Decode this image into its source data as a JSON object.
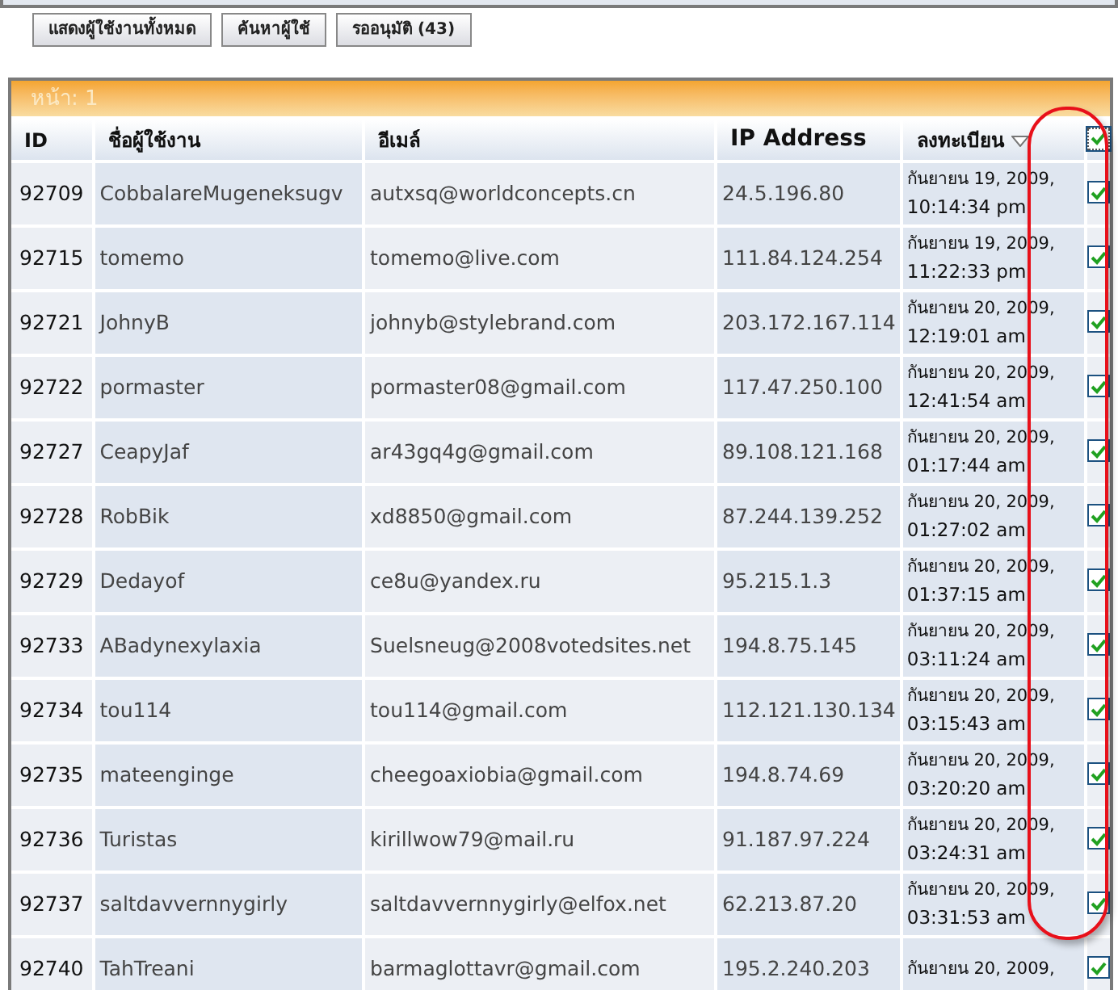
{
  "toolbar": {
    "buttons": [
      "แสดงผู้ใช้งานทั้งหมด",
      "ค้นหาผู้ใช้",
      "รออนุมัติ (43)"
    ]
  },
  "table": {
    "page_label": "หน้า: 1",
    "columns": [
      "ID",
      "ชื่อผู้ใช้งาน",
      "อีเมล์",
      "IP Address",
      "ลงทะเบียน"
    ],
    "select_all": {
      "checked": true
    },
    "rows": [
      {
        "id": "92709",
        "username": "CobbalareMugeneksugv",
        "email": "autxsq@worldconcepts.cn",
        "ip": "24.5.196.80",
        "date": "กันยายน 19, 2009,",
        "time": "10:14:34 pm",
        "checked": true
      },
      {
        "id": "92715",
        "username": "tomemo",
        "email": "tomemo@live.com",
        "ip": "111.84.124.254",
        "date": "กันยายน 19, 2009,",
        "time": "11:22:33 pm",
        "checked": true
      },
      {
        "id": "92721",
        "username": "JohnyB",
        "email": "johnyb@stylebrand.com",
        "ip": "203.172.167.114",
        "date": "กันยายน 20, 2009,",
        "time": "12:19:01 am",
        "checked": true
      },
      {
        "id": "92722",
        "username": "pormaster",
        "email": "pormaster08@gmail.com",
        "ip": "117.47.250.100",
        "date": "กันยายน 20, 2009,",
        "time": "12:41:54 am",
        "checked": true
      },
      {
        "id": "92727",
        "username": "CeapyJaf",
        "email": "ar43gq4g@gmail.com",
        "ip": "89.108.121.168",
        "date": "กันยายน 20, 2009,",
        "time": "01:17:44 am",
        "checked": true
      },
      {
        "id": "92728",
        "username": "RobBik",
        "email": "xd8850@gmail.com",
        "ip": "87.244.139.252",
        "date": "กันยายน 20, 2009,",
        "time": "01:27:02 am",
        "checked": true
      },
      {
        "id": "92729",
        "username": "Dedayof",
        "email": "ce8u@yandex.ru",
        "ip": "95.215.1.3",
        "date": "กันยายน 20, 2009,",
        "time": "01:37:15 am",
        "checked": true
      },
      {
        "id": "92733",
        "username": "ABadynexylaxia",
        "email": "Suelsneug@2008votedsites.net",
        "ip": "194.8.75.145",
        "date": "กันยายน 20, 2009,",
        "time": "03:11:24 am",
        "checked": true
      },
      {
        "id": "92734",
        "username": "tou114",
        "email": "tou114@gmail.com",
        "ip": "112.121.130.134",
        "date": "กันยายน 20, 2009,",
        "time": "03:15:43 am",
        "checked": true
      },
      {
        "id": "92735",
        "username": "mateenginge",
        "email": "cheegoaxiobia@gmail.com",
        "ip": "194.8.74.69",
        "date": "กันยายน 20, 2009,",
        "time": "03:20:20 am",
        "checked": true
      },
      {
        "id": "92736",
        "username": "Turistas",
        "email": "kirillwow79@mail.ru",
        "ip": "91.187.97.224",
        "date": "กันยายน 20, 2009,",
        "time": "03:24:31 am",
        "checked": true
      },
      {
        "id": "92737",
        "username": "saltdavvernnygirly",
        "email": "saltdavvernnygirly@elfox.net",
        "ip": "62.213.87.20",
        "date": "กันยายน 20, 2009,",
        "time": "03:31:53 am",
        "checked": true
      },
      {
        "id": "92740",
        "username": "TahTreani",
        "email": "barmaglottavr@gmail.com",
        "ip": "195.2.240.203",
        "date": "กันยายน 20, 2009,",
        "checked": true
      }
    ]
  }
}
